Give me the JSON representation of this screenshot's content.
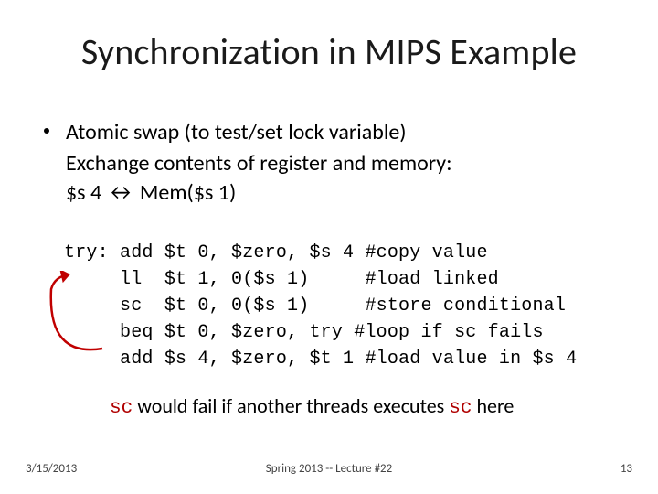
{
  "title": "Synchronization in MIPS Example",
  "bullet": {
    "line1": "Atomic swap (to test/set lock variable)",
    "line2": "Exchange contents of register and memory:",
    "line3": "$s 4 ↔ Mem($s 1)"
  },
  "code": "try: add $t 0, $zero, $s 4 #copy value\n     ll  $t 1, 0($s 1)     #load linked\n     sc  $t 0, 0($s 1)     #store conditional\n     beq $t 0, $zero, try #loop if sc fails\n     add $s 4, $zero, $t 1 #load value in $s 4",
  "note": {
    "mono1": "sc",
    "mid": " would fail if another threads executes ",
    "mono2": "sc",
    "tail": " here"
  },
  "footer": {
    "left": "3/15/2013",
    "center": "Spring 2013 -- Lecture #22",
    "right": "13"
  }
}
